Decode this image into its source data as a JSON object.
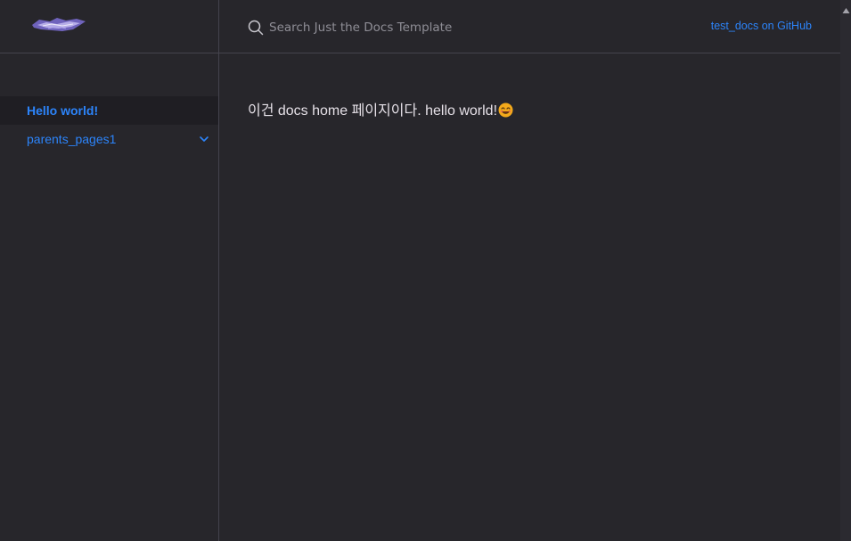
{
  "header": {
    "logo_icon": "site-logo",
    "search": {
      "placeholder": "Search Just the Docs Template",
      "value": "",
      "icon": "search-icon"
    },
    "aux_link": "test_docs on GitHub"
  },
  "sidebar": {
    "items": [
      {
        "label": "Hello world!",
        "active": true
      },
      {
        "label": "parents_pages1",
        "active": false,
        "expandable": true,
        "icon": "chevron-down-icon"
      }
    ]
  },
  "main": {
    "text": "이건 docs home 페이지이다. hello world!",
    "emoji": "smiling-face-emoji"
  },
  "colors": {
    "background": "#27262b",
    "link": "#2c84fa",
    "text": "#e6e1e8",
    "border": "#44434d"
  }
}
